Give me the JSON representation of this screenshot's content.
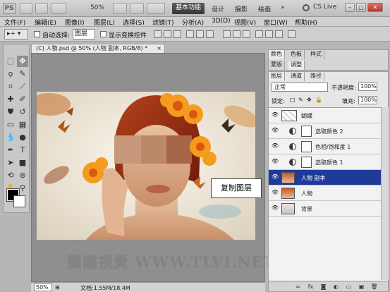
{
  "titlebar": {
    "logo": "PS",
    "zoom": "50%",
    "workspace_active": "基本功能",
    "workspaces": [
      "设计",
      "摄影",
      "绘画"
    ],
    "more": "»",
    "cs_live": "CS Live",
    "window_buttons": [
      "–",
      "□",
      "✕"
    ]
  },
  "menu": [
    "文件(F)",
    "编辑(E)",
    "图像(I)",
    "图层(L)",
    "选择(S)",
    "滤镜(T)",
    "分析(A)",
    "3D(D)",
    "视图(V)",
    "窗口(W)",
    "帮助(H)"
  ],
  "options": {
    "auto_select_label": "自动选择:",
    "auto_select_value": "图层",
    "show_transform_label": "显示变换控件"
  },
  "document": {
    "tab_title": "(C) 人物.psd @ 50% (人物 副本, RGB/8) *",
    "tab_close": "×",
    "tooltip": "复制图层",
    "zoom": "50%",
    "status": "文档:1.55M/18.4M"
  },
  "watermark": "騰龍視覺 WWW.TLVI.NET",
  "panels": {
    "top_tabs": [
      "颜色",
      "色板",
      "样式"
    ],
    "second_tabs": [
      "调整",
      "蒙版"
    ],
    "layer_tabs": [
      "图层",
      "通道",
      "路径"
    ],
    "blend_mode": "正常",
    "opacity_label": "不透明度:",
    "opacity_value": "100%",
    "lock_label": "锁定:",
    "fill_label": "填充:",
    "fill_value": "100%"
  },
  "layers": [
    {
      "name": "蝴蝶",
      "type": "pixel",
      "selected": false
    },
    {
      "name": "选取颜色 2",
      "type": "adjustment",
      "selected": false
    },
    {
      "name": "色相/饱和度 1",
      "type": "adjustment",
      "selected": false
    },
    {
      "name": "选取颜色 1",
      "type": "adjustment",
      "selected": false
    },
    {
      "name": "人物 副本",
      "type": "photo",
      "selected": true
    },
    {
      "name": "人物",
      "type": "photo",
      "selected": false
    },
    {
      "name": "背景",
      "type": "photo",
      "selected": false
    }
  ],
  "colors": {
    "selection": "#1f3b9a",
    "foreground": "#000000",
    "background": "#ffffff"
  }
}
